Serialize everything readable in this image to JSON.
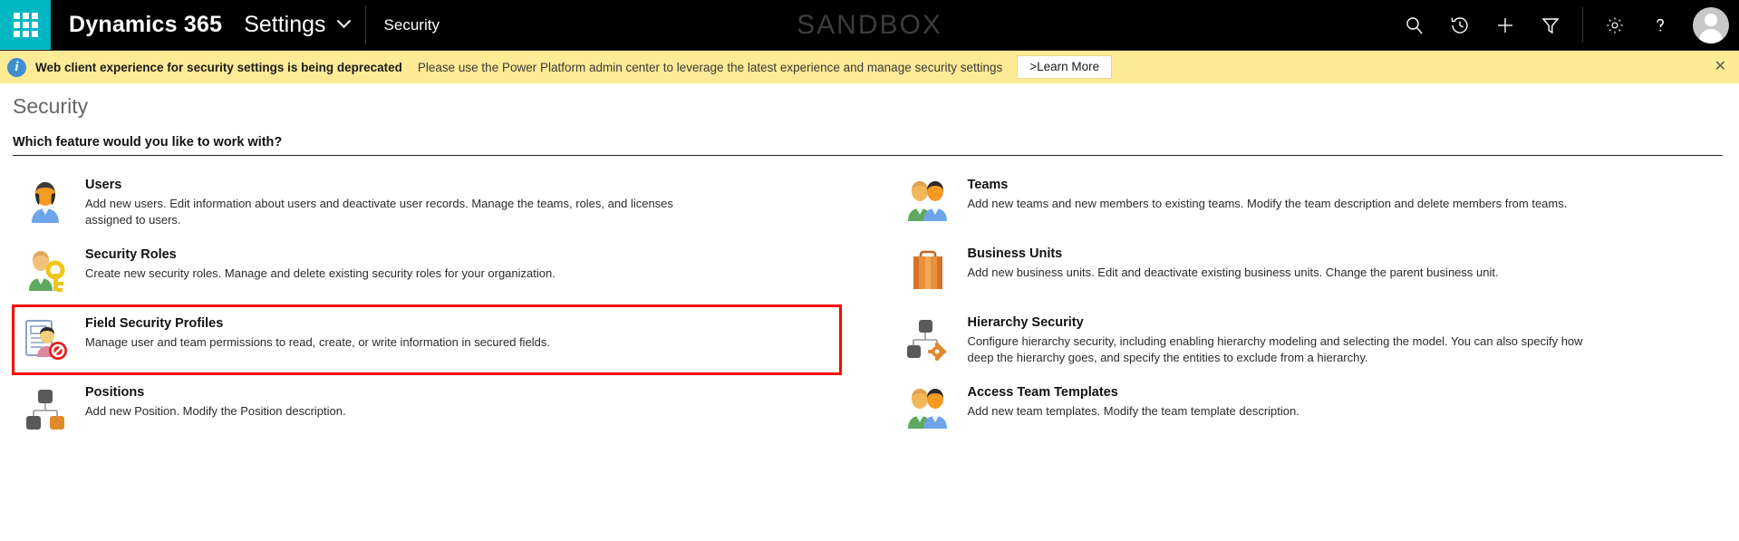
{
  "topbar": {
    "waffle_label": "app-launcher",
    "brand": "Dynamics 365",
    "app_name": "Settings",
    "page_context": "Security",
    "environment_label": "SANDBOX",
    "icons": [
      {
        "name": "search-icon",
        "label": "Search"
      },
      {
        "name": "history-icon",
        "label": "Recently viewed"
      },
      {
        "name": "plus-icon",
        "label": "Quick create"
      },
      {
        "name": "filter-icon",
        "label": "Advanced find"
      }
    ],
    "right_icons": [
      {
        "name": "gear-icon",
        "label": "Settings"
      },
      {
        "name": "help-icon",
        "label": "Help"
      }
    ],
    "avatar_label": "User profile"
  },
  "notification": {
    "icon": "info-icon",
    "title": "Web client experience for security settings is being deprecated",
    "message": "Please use the Power Platform admin center to leverage the latest experience and manage security settings",
    "button": ">Learn More",
    "close": "✕"
  },
  "page": {
    "title": "Security",
    "question": "Which feature would you like to work with?"
  },
  "colors": {
    "accent_teal": "#00b7c3",
    "notification_bg": "#fdeb95",
    "highlight_red": "#ff0000",
    "topbar_bg": "#000000"
  },
  "features": {
    "left": [
      {
        "icon": "user-icon",
        "title": "Users",
        "description": "Add new users. Edit information about users and deactivate user records. Manage the teams, roles, and licenses assigned to users.",
        "highlighted": false
      },
      {
        "icon": "security-roles-icon",
        "title": "Security Roles",
        "description": "Create new security roles. Manage and delete existing security roles for your organization.",
        "highlighted": false
      },
      {
        "icon": "field-security-profiles-icon",
        "title": "Field Security Profiles",
        "description": "Manage user and team permissions to read, create, or write information in secured fields.",
        "highlighted": true
      },
      {
        "icon": "positions-icon",
        "title": "Positions",
        "description": "Add new Position. Modify the Position description.",
        "highlighted": false
      }
    ],
    "right": [
      {
        "icon": "teams-icon",
        "title": "Teams",
        "description": "Add new teams and new members to existing teams. Modify the team description and delete members from teams.",
        "highlighted": false
      },
      {
        "icon": "business-units-icon",
        "title": "Business Units",
        "description": "Add new business units. Edit and deactivate existing business units. Change the parent business unit.",
        "highlighted": false
      },
      {
        "icon": "hierarchy-security-icon",
        "title": "Hierarchy Security",
        "description": "Configure hierarchy security, including enabling hierarchy modeling and selecting the model. You can also specify how deep the hierarchy goes, and specify the entities to exclude from a hierarchy.",
        "highlighted": false
      },
      {
        "icon": "access-team-templates-icon",
        "title": "Access Team Templates",
        "description": "Add new team templates. Modify the team template description.",
        "highlighted": false
      }
    ]
  }
}
